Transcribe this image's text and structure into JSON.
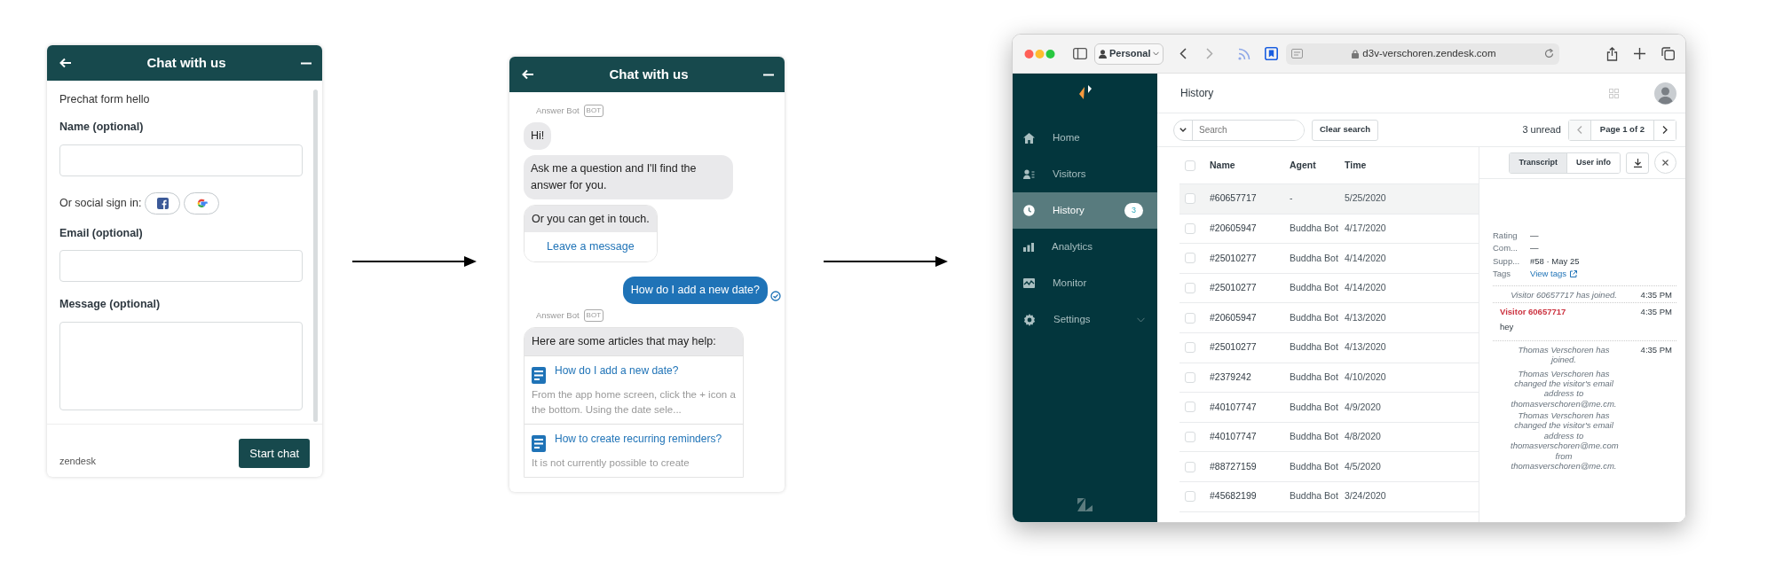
{
  "prechat_widget": {
    "title": "Chat with us",
    "items": [
      {
        "kind": "text",
        "text": "Prechat form hello"
      },
      {
        "kind": "input",
        "label": "Name (optional)"
      },
      {
        "kind": "social",
        "label": "Or social sign in:"
      },
      {
        "kind": "input",
        "label": "Email (optional)"
      },
      {
        "kind": "textarea",
        "label": "Message (optional)"
      }
    ],
    "brand": "zendesk",
    "submit": "Start chat"
  },
  "chat_widget": {
    "title": "Chat with us",
    "messages": [
      {
        "kind": "sender",
        "name": "Answer Bot",
        "badge": "BOT"
      },
      {
        "kind": "bot",
        "text": "Hi!"
      },
      {
        "kind": "bot",
        "text": "Ask me a question and I'll find the answer for you."
      },
      {
        "kind": "bot_action",
        "text": "Or you can get in touch.",
        "action": "Leave a message"
      },
      {
        "kind": "user",
        "text": "How do I add a new date?"
      },
      {
        "kind": "sender",
        "name": "Answer Bot",
        "badge": "BOT"
      },
      {
        "kind": "articles",
        "text": "Here are some articles that may help:",
        "articles": [
          {
            "title": "How do I add a new date?",
            "snippet": "From the app home screen, click the + icon a the bottom. Using the date sele..."
          },
          {
            "title": "How to create recurring reminders?",
            "snippet": "It is not currently possible to create"
          }
        ]
      }
    ]
  },
  "browser": {
    "profile": "Personal",
    "url": "d3v-verschoren.zendesk.com"
  },
  "sidebar": {
    "items": [
      {
        "label": "Home",
        "selected": false
      },
      {
        "label": "Visitors",
        "selected": false
      },
      {
        "label": "History",
        "selected": true,
        "badge": "3"
      },
      {
        "label": "Analytics",
        "selected": false
      },
      {
        "label": "Monitor",
        "selected": false
      },
      {
        "label": "Settings",
        "selected": false,
        "expandable": true
      }
    ]
  },
  "page": {
    "title": "History"
  },
  "toolbar": {
    "search_placeholder": "Search",
    "clear": "Clear search",
    "unread": "3 unread",
    "pager": "Page 1 of 2"
  },
  "table": {
    "columns": [
      "Name",
      "Agent",
      "Time"
    ],
    "all_checked": false,
    "rows": [
      {
        "cells": [
          "#60657717",
          "-",
          "5/25/2020"
        ],
        "selected": true,
        "checked": false
      },
      {
        "cells": [
          "#20605947",
          "Buddha Bot",
          "4/17/2020"
        ],
        "selected": false,
        "checked": false
      },
      {
        "cells": [
          "#25010277",
          "Buddha Bot",
          "4/14/2020"
        ],
        "selected": false,
        "checked": false
      },
      {
        "cells": [
          "#25010277",
          "Buddha Bot",
          "4/14/2020"
        ],
        "selected": false,
        "checked": false
      },
      {
        "cells": [
          "#20605947",
          "Buddha Bot",
          "4/13/2020"
        ],
        "selected": false,
        "checked": false
      },
      {
        "cells": [
          "#25010277",
          "Buddha Bot",
          "4/13/2020"
        ],
        "selected": false,
        "checked": false
      },
      {
        "cells": [
          "#2379242",
          "Buddha Bot",
          "4/10/2020"
        ],
        "selected": false,
        "checked": false
      },
      {
        "cells": [
          "#40107747",
          "Buddha Bot",
          "4/9/2020"
        ],
        "selected": false,
        "checked": false
      },
      {
        "cells": [
          "#40107747",
          "Buddha Bot",
          "4/8/2020"
        ],
        "selected": false,
        "checked": false
      },
      {
        "cells": [
          "#88727159",
          "Buddha Bot",
          "4/5/2020"
        ],
        "selected": false,
        "checked": false
      },
      {
        "cells": [
          "#45682199",
          "Buddha Bot",
          "3/24/2020"
        ],
        "selected": false,
        "checked": false
      }
    ]
  },
  "detail": {
    "tabs": [
      {
        "label": "Transcript",
        "selected": true
      },
      {
        "label": "User info",
        "selected": false
      }
    ],
    "fields": [
      {
        "label": "Rating",
        "value": "—",
        "kind": "text"
      },
      {
        "label": "Com...",
        "value": "—",
        "kind": "text"
      },
      {
        "label": "Supp...",
        "value": "#58 · May 25",
        "kind": "text"
      },
      {
        "label": "Tags",
        "value": "View tags",
        "kind": "link"
      }
    ],
    "events": [
      {
        "kind": "system",
        "text": "Visitor 60657717 has joined.",
        "time": "4:35 PM"
      },
      {
        "kind": "message",
        "author": "Visitor 60657717",
        "time": "4:35 PM",
        "text": "hey"
      },
      {
        "kind": "system",
        "text": "Thomas Verschoren has joined.",
        "time": "4:35 PM"
      },
      {
        "kind": "system",
        "text": "Thomas Verschoren has changed the visitor's email address to thomasverschoren@me.cm."
      },
      {
        "kind": "system",
        "text": "Thomas Verschoren has changed the visitor's email address to thomasverschoren@me.com from thomasverschoren@me.cm."
      }
    ]
  }
}
